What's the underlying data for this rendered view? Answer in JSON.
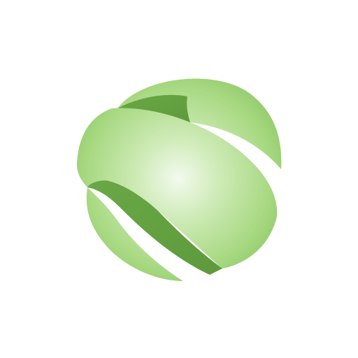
{
  "image": {
    "logo_icon": "green-ribbon-sphere-icon",
    "colors": {
      "background": "#ffffff",
      "ribbon_light": "#f3faee",
      "ribbon_mid": "#a8d982",
      "ribbon_edge": "#8cc766",
      "band_inner": "#6aa846",
      "band_inner_dark": "#5e9a3c"
    }
  }
}
